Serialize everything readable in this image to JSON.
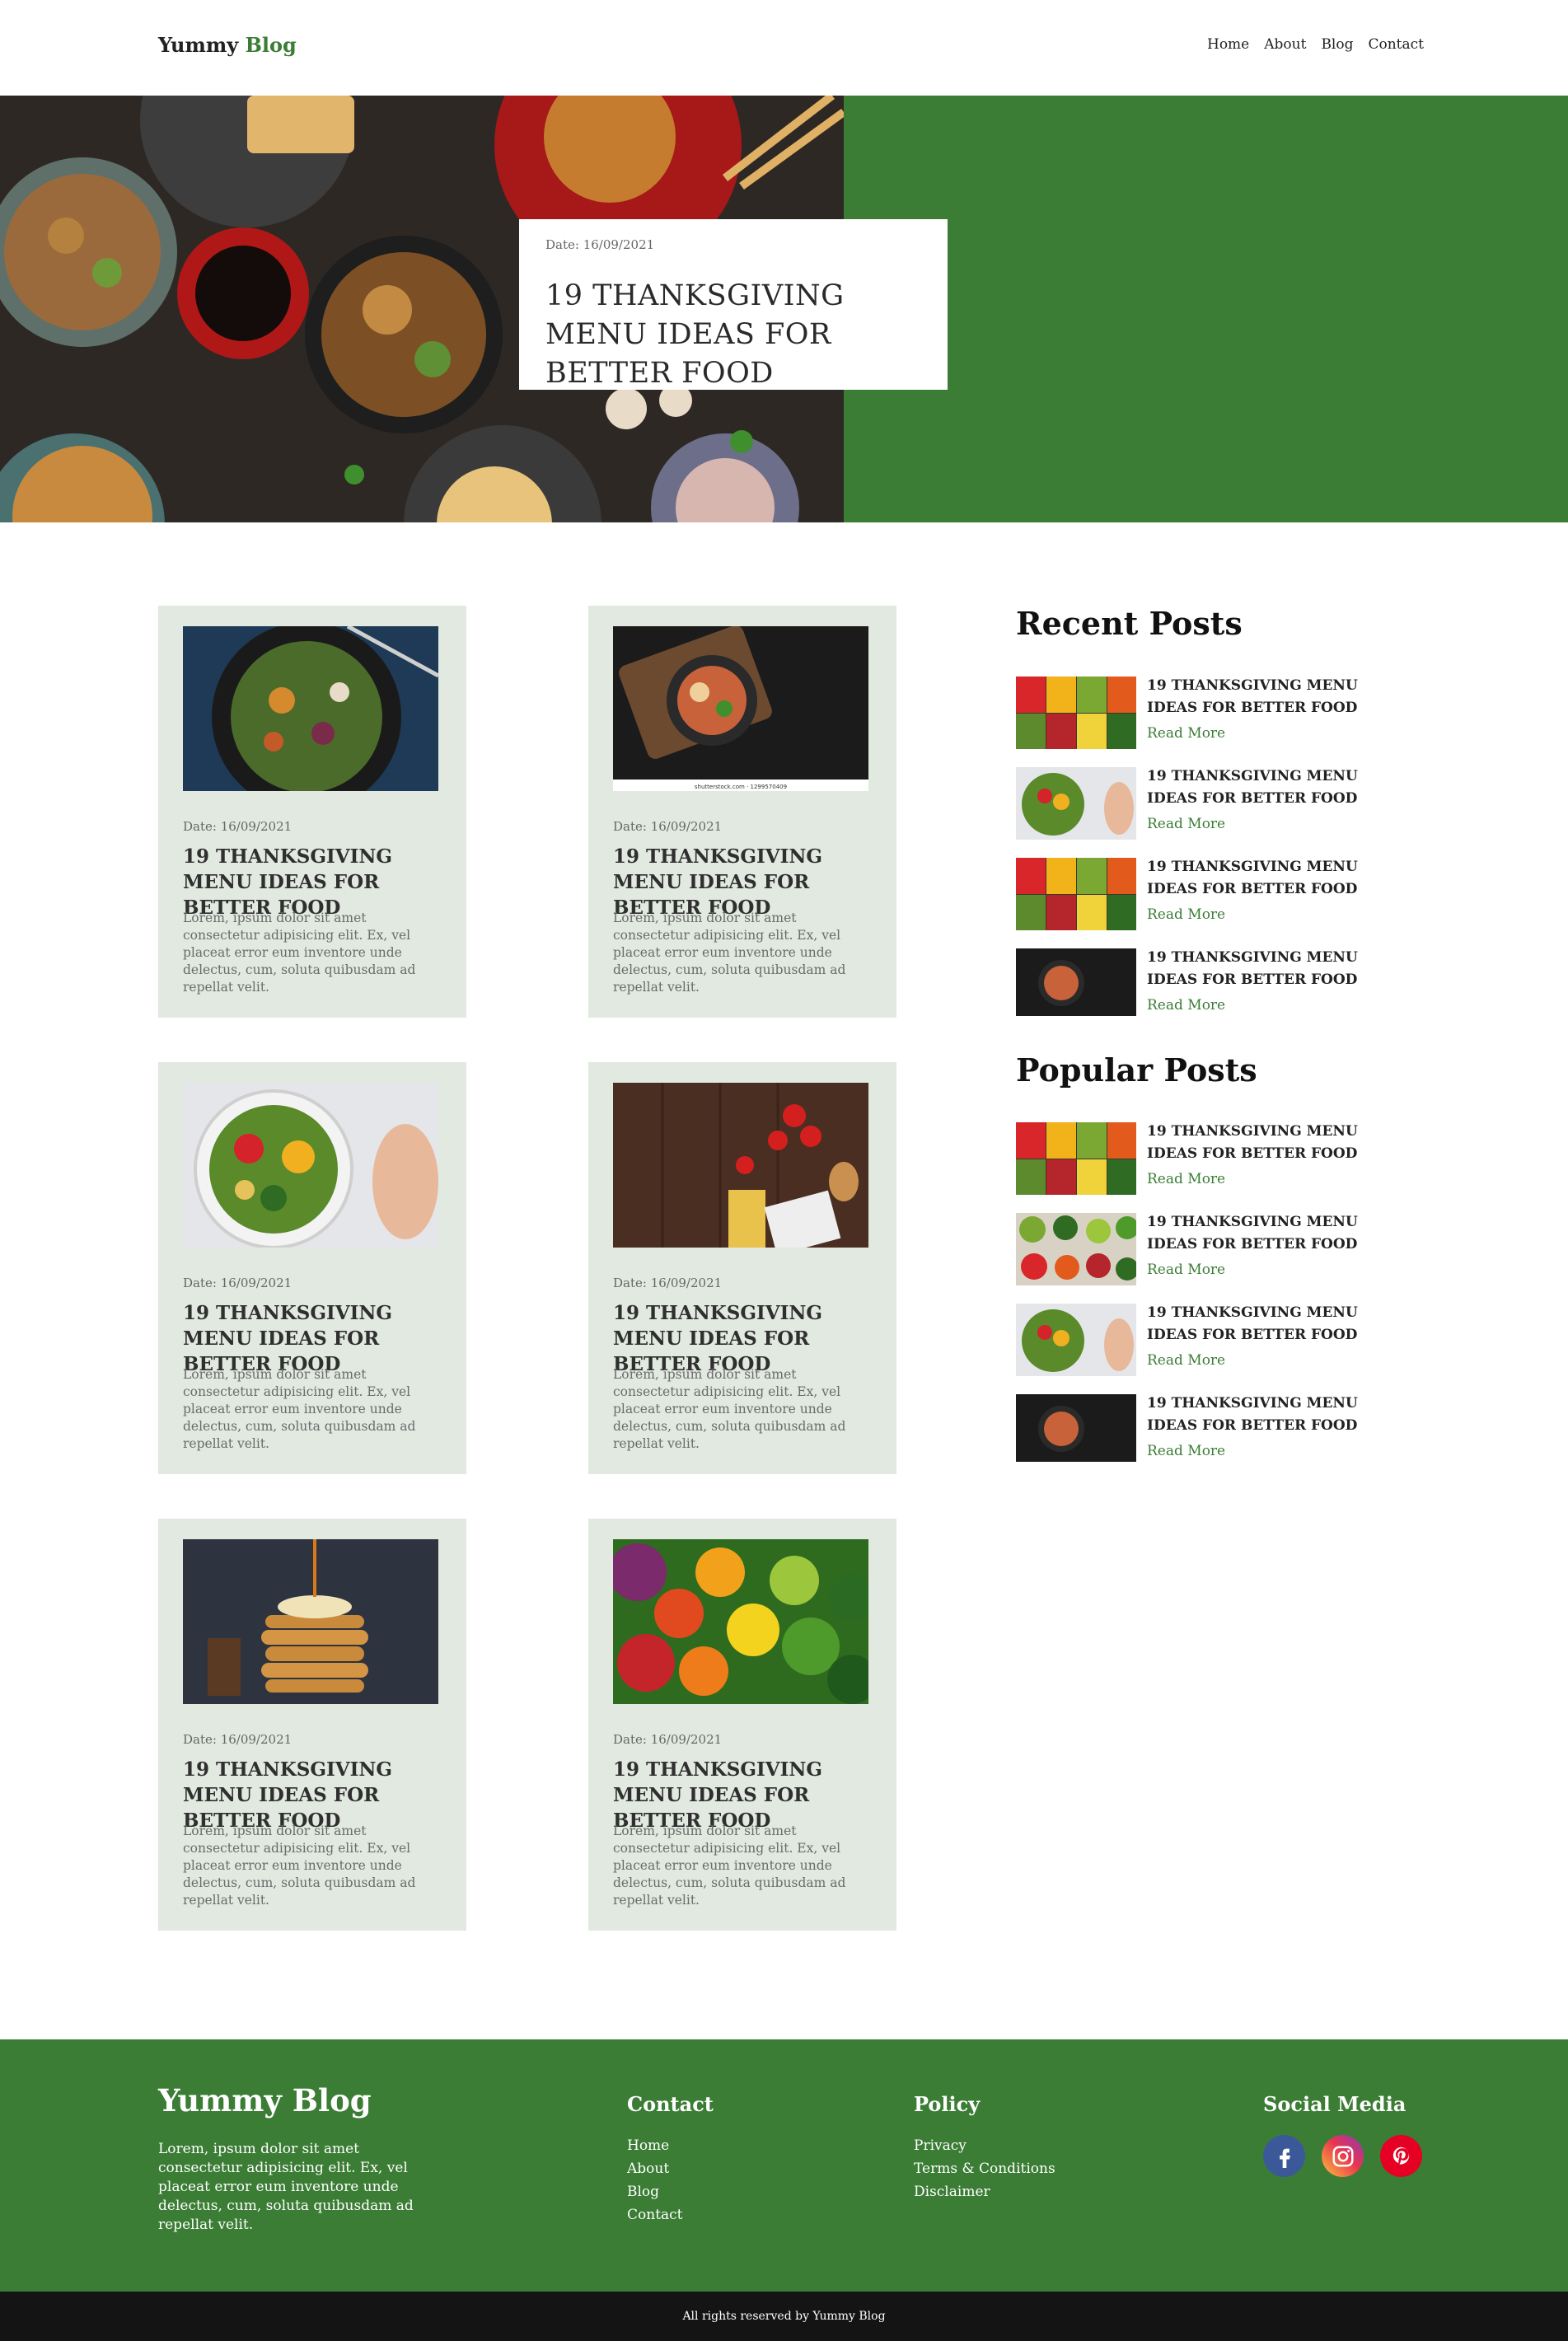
{
  "nav": {
    "logo_main": "Yummy",
    "logo_accent": "Blog",
    "links": [
      "Home",
      "About",
      "Blog",
      "Contact"
    ]
  },
  "hero": {
    "date": "Date: 16/09/2021",
    "title": "19 THANKSGIVING MENU IDEAS FOR BETTER FOOD"
  },
  "posts": [
    {
      "date": "Date: 16/09/2021",
      "title": "19 THANKSGIVING MENU IDEAS FOR BETTER FOOD",
      "excerpt": "Lorem, ipsum dolor sit amet consectetur adipisicing elit. Ex, vel placeat error eum inventore unde delectus, cum, soluta quibusdam ad repellat velit."
    },
    {
      "date": "Date: 16/09/2021",
      "title": "19 THANKSGIVING MENU IDEAS FOR BETTER FOOD",
      "excerpt": "Lorem, ipsum dolor sit amet consectetur adipisicing elit. Ex, vel placeat error eum inventore unde delectus, cum, soluta quibusdam ad repellat velit.",
      "watermark": "shutterstock.com · 1299570409"
    },
    {
      "date": "Date: 16/09/2021",
      "title": "19 THANKSGIVING MENU IDEAS FOR BETTER FOOD",
      "excerpt": "Lorem, ipsum dolor sit amet consectetur adipisicing elit. Ex, vel placeat error eum inventore unde delectus, cum, soluta quibusdam ad repellat velit."
    },
    {
      "date": "Date: 16/09/2021",
      "title": "19 THANKSGIVING MENU IDEAS FOR BETTER FOOD",
      "excerpt": "Lorem, ipsum dolor sit amet consectetur adipisicing elit. Ex, vel placeat error eum inventore unde delectus, cum, soluta quibusdam ad repellat velit."
    },
    {
      "date": "Date: 16/09/2021",
      "title": "19 THANKSGIVING MENU IDEAS FOR BETTER FOOD",
      "excerpt": "Lorem, ipsum dolor sit amet consectetur adipisicing elit. Ex, vel placeat error eum inventore unde delectus, cum, soluta quibusdam ad repellat velit."
    },
    {
      "date": "Date: 16/09/2021",
      "title": "19 THANKSGIVING MENU IDEAS FOR BETTER FOOD",
      "excerpt": "Lorem, ipsum dolor sit amet consectetur adipisicing elit. Ex, vel placeat error eum inventore unde delectus, cum, soluta quibusdam ad repellat velit."
    }
  ],
  "recent": {
    "heading": "Recent Posts",
    "items": [
      {
        "title": "19 THANKSGIVING MENU IDEAS FOR BETTER FOOD",
        "more": "Read More"
      },
      {
        "title": "19 THANKSGIVING MENU IDEAS FOR BETTER FOOD",
        "more": "Read More"
      },
      {
        "title": "19 THANKSGIVING MENU IDEAS FOR BETTER FOOD",
        "more": "Read More"
      },
      {
        "title": "19 THANKSGIVING MENU IDEAS FOR BETTER FOOD",
        "more": "Read More"
      }
    ]
  },
  "popular": {
    "heading": "Popular Posts",
    "items": [
      {
        "title": "19 THANKSGIVING MENU IDEAS FOR BETTER FOOD",
        "more": "Read More"
      },
      {
        "title": "19 THANKSGIVING MENU IDEAS FOR BETTER FOOD",
        "more": "Read More"
      },
      {
        "title": "19 THANKSGIVING MENU IDEAS FOR BETTER FOOD",
        "more": "Read More"
      },
      {
        "title": "19 THANKSGIVING MENU IDEAS FOR BETTER FOOD",
        "more": "Read More"
      }
    ]
  },
  "footer": {
    "logo": "Yummy Blog",
    "about": "Lorem, ipsum dolor sit amet consectetur adipisicing elit. Ex, vel placeat error eum inventore unde delectus, cum, soluta quibusdam ad repellat velit.",
    "contact_heading": "Contact",
    "contact_links": [
      "Home",
      "About",
      "Blog",
      "Contact"
    ],
    "policy_heading": "Policy",
    "policy_links": [
      "Privacy",
      "Terms & Conditions",
      "Disclaimer"
    ],
    "social_heading": "Social Media",
    "social_icons": [
      "facebook-icon",
      "instagram-icon",
      "pinterest-icon"
    ],
    "copyright": "All rights reserved by Yummy Blog"
  },
  "colors": {
    "brand_green": "#3b7d35",
    "card_bg": "#e1e9e0",
    "dark_bar": "#141414"
  }
}
